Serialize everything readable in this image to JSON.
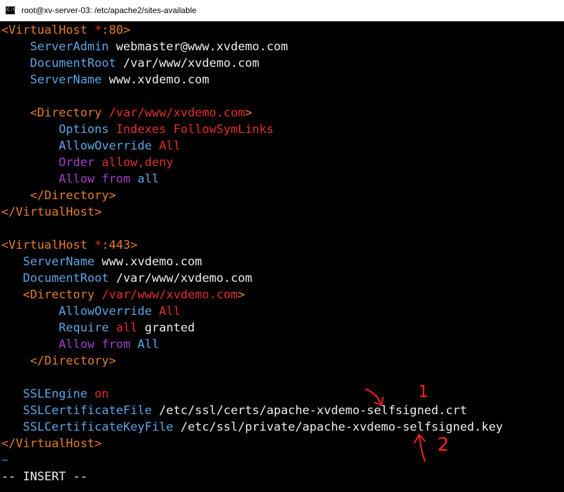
{
  "window": {
    "title": "root@xv-server-03: /etc/apache2/sites-available",
    "icon": "cmd-icon",
    "icon_text": "C:\\"
  },
  "colors": {
    "tag": "#e67e22",
    "directive": "#5aa6e8",
    "value": "#e32d2d",
    "keyword": "#a33fcc",
    "text": "#ededed",
    "tilde": "#3b7ddd",
    "annotation": "#ff2020"
  },
  "lines": [
    [
      {
        "t": "<VirtualHost ",
        "c": "tag"
      },
      {
        "t": "*",
        "c": "value"
      },
      {
        "t": ":80>",
        "c": "tag"
      }
    ],
    [
      {
        "t": "    ServerAdmin",
        "c": "directive"
      },
      {
        "t": " webmaster@www.xvdemo.com",
        "c": "text"
      }
    ],
    [
      {
        "t": "    DocumentRoot",
        "c": "directive"
      },
      {
        "t": " /var/www/xvdemo.com",
        "c": "text"
      }
    ],
    [
      {
        "t": "    ServerName",
        "c": "directive"
      },
      {
        "t": " www.xvdemo.com",
        "c": "text"
      }
    ],
    [],
    [
      {
        "t": "    <Directory ",
        "c": "tag"
      },
      {
        "t": "/var/www/xvdemo.com",
        "c": "value"
      },
      {
        "t": ">",
        "c": "tag"
      }
    ],
    [
      {
        "t": "        Options",
        "c": "directive"
      },
      {
        "t": " Indexes FollowSymLinks",
        "c": "value"
      }
    ],
    [
      {
        "t": "        AllowOverride",
        "c": "directive"
      },
      {
        "t": " All",
        "c": "value"
      }
    ],
    [
      {
        "t": "        Order",
        "c": "keyword"
      },
      {
        "t": " allow,deny",
        "c": "value"
      }
    ],
    [
      {
        "t": "        Allow from",
        "c": "keyword"
      },
      {
        "t": " all",
        "c": "directive"
      }
    ],
    [
      {
        "t": "    </Directory>",
        "c": "tag"
      }
    ],
    [
      {
        "t": "</VirtualHost>",
        "c": "tag"
      }
    ],
    [],
    [
      {
        "t": "<VirtualHost ",
        "c": "tag"
      },
      {
        "t": "*",
        "c": "value"
      },
      {
        "t": ":443>",
        "c": "tag"
      }
    ],
    [
      {
        "t": "   ServerName",
        "c": "directive"
      },
      {
        "t": " www.xvdemo.com",
        "c": "text"
      }
    ],
    [
      {
        "t": "   DocumentRoot",
        "c": "directive"
      },
      {
        "t": " /var/www/xvdemo.com",
        "c": "text"
      }
    ],
    [
      {
        "t": "   <Directory ",
        "c": "tag"
      },
      {
        "t": "/var/www/xvdemo.com",
        "c": "value"
      },
      {
        "t": ">",
        "c": "tag"
      }
    ],
    [
      {
        "t": "        AllowOverride",
        "c": "directive"
      },
      {
        "t": " All",
        "c": "value"
      }
    ],
    [
      {
        "t": "        Require",
        "c": "directive"
      },
      {
        "t": " all",
        "c": "value"
      },
      {
        "t": " granted",
        "c": "text"
      }
    ],
    [
      {
        "t": "        Allow from",
        "c": "keyword"
      },
      {
        "t": " All",
        "c": "directive"
      }
    ],
    [
      {
        "t": "    </Directory>",
        "c": "tag"
      }
    ],
    [],
    [
      {
        "t": "   SSLEngine",
        "c": "directive"
      },
      {
        "t": " on",
        "c": "value"
      }
    ],
    [
      {
        "t": "   SSLCertificateFile",
        "c": "directive"
      },
      {
        "t": " /etc/ssl/certs/apache-xvdemo-selfsigned.crt",
        "c": "text"
      }
    ],
    [
      {
        "t": "   SSLCertificateKeyFile",
        "c": "directive"
      },
      {
        "t": " /etc/ssl/private/apache-xvdemo-selfsigned.key",
        "c": "text"
      }
    ],
    [
      {
        "t": "</VirtualHost>",
        "c": "tag"
      }
    ],
    [
      {
        "t": "~",
        "c": "tilde"
      }
    ],
    [
      {
        "t": "-- INSERT --",
        "c": "text"
      }
    ]
  ],
  "annotations": {
    "mark1": "1",
    "mark2": "2"
  }
}
